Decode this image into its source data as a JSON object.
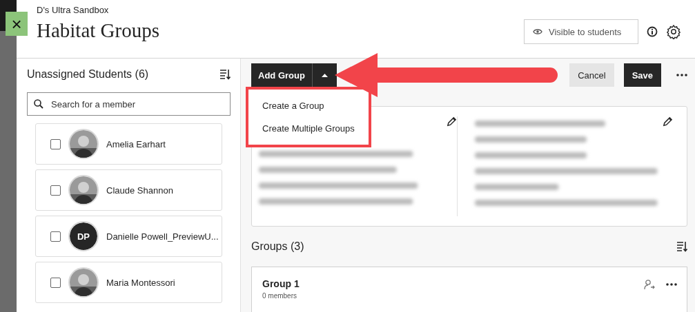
{
  "close_button": {
    "label": "×"
  },
  "header": {
    "course": "D's Ultra Sandbox",
    "title": "Habitat Groups",
    "visibility": "Visible to students"
  },
  "unassigned": {
    "title": "Unassigned Students (6)",
    "search": {
      "placeholder": "Search for a member"
    },
    "students": [
      {
        "name": "Amelia Earhart",
        "checked": false
      },
      {
        "name": "Claude Shannon",
        "checked": false
      },
      {
        "name": "Danielle Powell_PreviewU...",
        "checked": false,
        "avatar": {
          "kind": "initials",
          "initials": "DP"
        }
      },
      {
        "name": "Maria Montessori",
        "checked": false
      }
    ]
  },
  "toolbar": {
    "add_group": "Add Group",
    "buttons": [
      {
        "label": "Cancel",
        "kind": "secondary"
      },
      {
        "label": "Save",
        "kind": "primary"
      }
    ]
  },
  "add_menu": {
    "expanded": true,
    "items": [
      "Create a Group",
      "Create Multiple Groups"
    ]
  },
  "groups": {
    "title": "Groups (3)",
    "items": [
      {
        "name": "Group 1",
        "members": "0 members"
      }
    ]
  }
}
